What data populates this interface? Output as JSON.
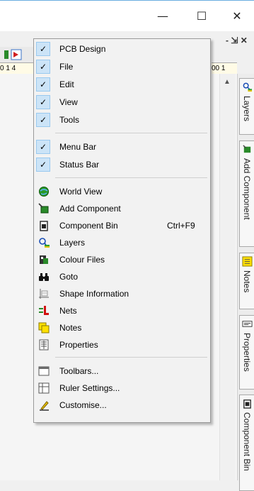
{
  "window": {
    "minimize_icon": "minimize-icon",
    "maximize_icon": "maximize-icon",
    "close_icon": "close-icon"
  },
  "ruler": {
    "left_text": "0  1  4",
    "right_text": "00  1"
  },
  "menu": {
    "checked_items": [
      {
        "label": "PCB Design"
      },
      {
        "label": "File"
      },
      {
        "label": "Edit"
      },
      {
        "label": "View"
      },
      {
        "label": "Tools"
      }
    ],
    "bar_items": [
      {
        "label": "Menu Bar"
      },
      {
        "label": "Status Bar"
      }
    ],
    "panel_items": [
      {
        "label": "World View",
        "icon": "globe-icon"
      },
      {
        "label": "Add Component",
        "icon": "add-component-icon"
      },
      {
        "label": "Component Bin",
        "icon": "component-bin-icon",
        "shortcut": "Ctrl+F9"
      },
      {
        "label": "Layers",
        "icon": "layers-icon"
      },
      {
        "label": "Colour Files",
        "icon": "colour-files-icon"
      },
      {
        "label": "Goto",
        "icon": "binoculars-icon"
      },
      {
        "label": "Shape Information",
        "icon": "shape-info-icon"
      },
      {
        "label": "Nets",
        "icon": "nets-icon"
      },
      {
        "label": "Notes",
        "icon": "notes-icon"
      },
      {
        "label": "Properties",
        "icon": "properties-icon"
      }
    ],
    "settings_items": [
      {
        "label": "Toolbars...",
        "icon": "toolbars-icon"
      },
      {
        "label": "Ruler Settings...",
        "icon": "ruler-settings-icon"
      },
      {
        "label": "Customise...",
        "icon": "customise-icon"
      }
    ]
  },
  "side_tabs": [
    {
      "label": "Layers",
      "icon": "layers-icon"
    },
    {
      "label": "Add Component",
      "icon": "add-component-icon"
    },
    {
      "label": "Notes",
      "icon": "notes-icon"
    },
    {
      "label": "Properties",
      "icon": "properties-icon"
    },
    {
      "label": "Component Bin",
      "icon": "component-bin-icon"
    }
  ],
  "colors": {
    "check_bg": "#cce4f7",
    "check_border": "#99c9ef",
    "menu_bg": "#f2f2f2"
  }
}
